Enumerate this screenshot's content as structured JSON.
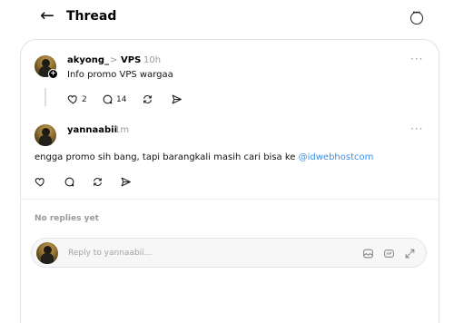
{
  "header": {
    "back_icon": "arrow-left-icon",
    "title": "Thread",
    "more_icon": "ellipsis-circle-icon"
  },
  "parent_post": {
    "username": "akyong_",
    "separator": ">",
    "tag": "VPS",
    "time": "10h",
    "text": "Info promo VPS wargaa",
    "likes": "2",
    "comments": "14",
    "more": "···"
  },
  "reply_post": {
    "username": "yannaabii",
    "time": "1m",
    "text": "engga promo sih bang, tapi barangkali masih cari bisa ke ",
    "mention": "@idwebhostcom",
    "more": "···"
  },
  "replies_status": "No replies yet",
  "composer": {
    "placeholder": "Reply to yannaabii...",
    "icons": [
      "image-icon",
      "gif-icon",
      "expand-icon"
    ]
  },
  "colors": {
    "mention": "#3c8ee8",
    "muted": "#999999",
    "border": "#e2e2e2"
  }
}
